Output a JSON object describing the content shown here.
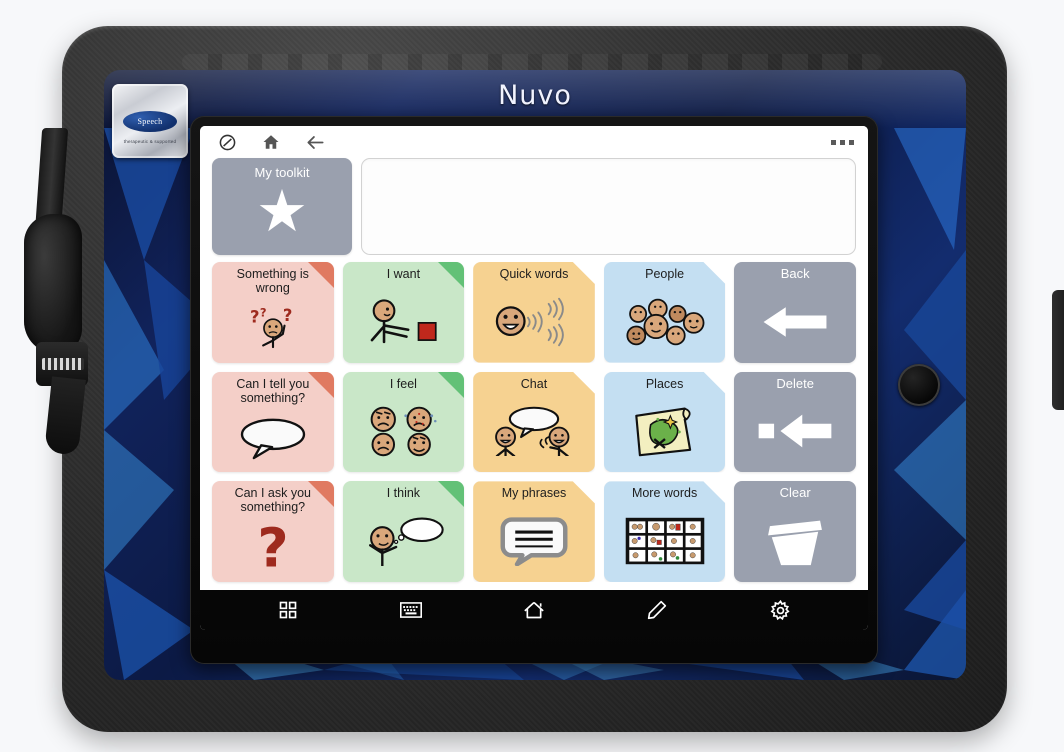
{
  "device": {
    "brand_label": "Nuvo",
    "badge": {
      "logo_text": "Speech",
      "tagline": "therapeutic  &  supported"
    },
    "case_color": "#11235c",
    "frame_color": "#272727"
  },
  "app_toolbar": {
    "icons": [
      {
        "name": "mute-circle-icon",
        "glyph": "mute"
      },
      {
        "name": "home-icon",
        "glyph": "home"
      },
      {
        "name": "back-arrow-icon",
        "glyph": "back"
      }
    ],
    "overflow_menu": "more-options-icon"
  },
  "message_bar": {
    "value": "",
    "placeholder": ""
  },
  "toolkit": {
    "label": "My toolkit",
    "icon": "star-icon",
    "color": "#9aa0ae"
  },
  "grid": {
    "columns": 5,
    "rows": 3,
    "cells": [
      {
        "label": "Something is wrong",
        "type": "phrase",
        "color": "#f4cfc8",
        "fold": "#e07a61",
        "icon": "confused-person-icon"
      },
      {
        "label": "I want",
        "type": "phrase",
        "color": "#c9e7c8",
        "fold": "#63c177",
        "icon": "person-pointing-icon"
      },
      {
        "label": "Quick words",
        "type": "folder",
        "color": "#f6d291",
        "fold": "",
        "icon": "talking-face-icon"
      },
      {
        "label": "People",
        "type": "folder",
        "color": "#c4dff2",
        "fold": "",
        "icon": "group-of-faces-icon"
      },
      {
        "label": "Back",
        "type": "command",
        "color": "#9aa0ae",
        "fold": "",
        "icon": "left-arrow-icon"
      },
      {
        "label": "Can I tell you something?",
        "type": "phrase",
        "color": "#f4cfc8",
        "fold": "#e07a61",
        "icon": "speech-bubble-icon"
      },
      {
        "label": "I feel",
        "type": "phrase",
        "color": "#c9e7c8",
        "fold": "#63c177",
        "icon": "four-emotion-faces-icon"
      },
      {
        "label": "Chat",
        "type": "folder",
        "color": "#f6d291",
        "fold": "",
        "icon": "two-people-talking-icon"
      },
      {
        "label": "Places",
        "type": "folder",
        "color": "#c4dff2",
        "fold": "",
        "icon": "treasure-map-icon"
      },
      {
        "label": "Delete",
        "type": "command",
        "color": "#9aa0ae",
        "fold": "",
        "icon": "backspace-icon"
      },
      {
        "label": "Can I ask you something?",
        "type": "phrase",
        "color": "#f4cfc8",
        "fold": "#e07a61",
        "icon": "question-mark-icon"
      },
      {
        "label": "I think",
        "type": "phrase",
        "color": "#c9e7c8",
        "fold": "#63c177",
        "icon": "thinking-person-icon"
      },
      {
        "label": "My phrases",
        "type": "folder",
        "color": "#f6d291",
        "fold": "",
        "icon": "lined-speech-bubble-icon"
      },
      {
        "label": "More words",
        "type": "folder",
        "color": "#c4dff2",
        "fold": "",
        "icon": "symbol-grid-icon"
      },
      {
        "label": "Clear",
        "type": "command",
        "color": "#9aa0ae",
        "fold": "",
        "icon": "trash-bin-icon"
      }
    ]
  },
  "device_navbar": {
    "items": [
      {
        "name": "apps-grid-icon"
      },
      {
        "name": "keyboard-icon"
      },
      {
        "name": "home-outline-icon"
      },
      {
        "name": "pencil-icon"
      },
      {
        "name": "settings-gear-icon"
      }
    ]
  }
}
